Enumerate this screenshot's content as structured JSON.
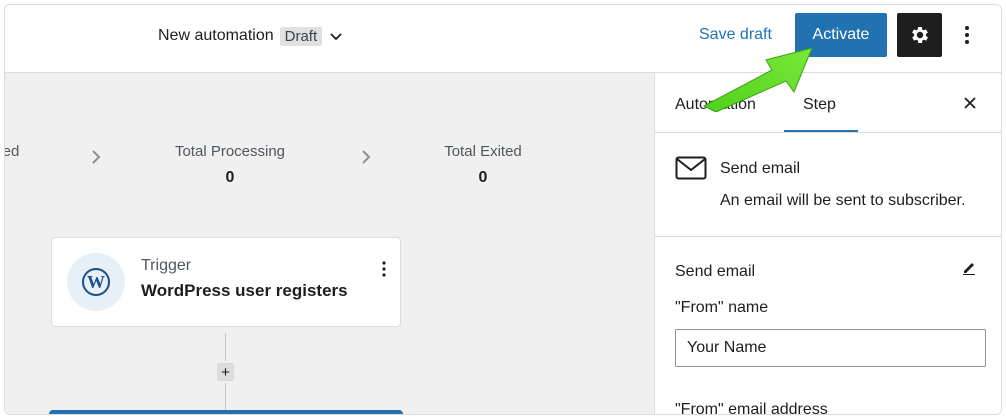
{
  "header": {
    "title": "New automation",
    "status_badge": "Draft",
    "save_draft_label": "Save draft",
    "activate_label": "Activate",
    "settings_icon": "gear-icon",
    "more_icon": "more-vertical-icon",
    "accent_color": "#2271b1"
  },
  "stats": [
    {
      "label": "ed",
      "value": ""
    },
    {
      "label": "Total Processing",
      "value": "0"
    },
    {
      "label": "Total Exited",
      "value": "0"
    }
  ],
  "trigger": {
    "label": "Trigger",
    "title": "WordPress user registers",
    "icon": "wordpress-icon"
  },
  "sidebar": {
    "tabs": [
      {
        "label": "Automation",
        "active": false
      },
      {
        "label": "Step",
        "active": true
      }
    ],
    "step": {
      "name": "Send email",
      "description": "An email will be sent to subscriber.",
      "icon": "mail-icon"
    },
    "panel": {
      "title": "Send email",
      "from_name_label": "\"From\" name",
      "from_name_value": "Your Name",
      "from_address_label": "\"From\" email address"
    }
  }
}
